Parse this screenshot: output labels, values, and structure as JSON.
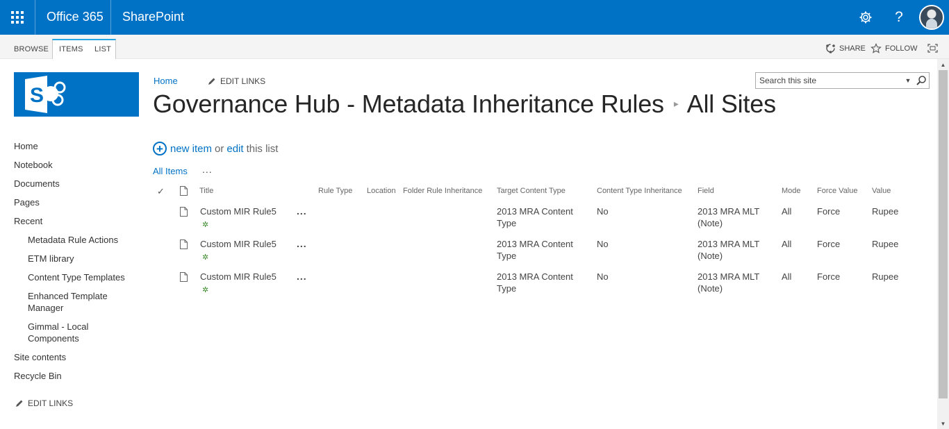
{
  "suitebar": {
    "brand": "Office 365",
    "app": "SharePoint",
    "icons": [
      "app-launcher-icon",
      "settings-gear-icon",
      "help-icon",
      "user-avatar"
    ],
    "help_glyph": "?",
    "color": "#0072c6"
  },
  "ribbon": {
    "tabs": [
      "BROWSE",
      "ITEMS",
      "LIST"
    ],
    "share": "SHARE",
    "follow": "FOLLOW"
  },
  "topnav": {
    "home": "Home",
    "edit_links": "EDIT LINKS"
  },
  "search": {
    "placeholder": "Search this site"
  },
  "title": {
    "site": "Governance Hub - Metadata Inheritance Rules",
    "list": "All Sites"
  },
  "quicklaunch": {
    "items": [
      "Home",
      "Notebook",
      "Documents",
      "Pages",
      "Recent"
    ],
    "recent": [
      "Metadata Rule Actions",
      "ETM library",
      "Content Type Templates",
      "Enhanced Template Manager",
      "Gimmal - Local Components"
    ],
    "bottom": [
      "Site contents",
      "Recycle Bin"
    ],
    "edit_links": "EDIT LINKS"
  },
  "toolbar": {
    "new_item": "new item",
    "or": "or",
    "edit": "edit",
    "this_list": "this list",
    "view": "All Items",
    "more": "..."
  },
  "table": {
    "columns": [
      "Title",
      "Rule Type",
      "Location",
      "Folder Rule Inheritance",
      "Target Content Type",
      "Content Type Inheritance",
      "Field",
      "Mode",
      "Force Value",
      "Value"
    ],
    "rows": [
      {
        "title": "Custom MIR Rule5",
        "rule_type": "",
        "location": "",
        "folder_rule_inheritance": "",
        "target_ct_1": "2013  MRA Content",
        "target_ct_2": "Type",
        "ct_inheritance": "No",
        "field_1": "2013 MRA MLT",
        "field_2": "(Note)",
        "mode": "All",
        "force": "Force",
        "value": "Rupee"
      },
      {
        "title": "Custom MIR Rule5",
        "rule_type": "",
        "location": "",
        "folder_rule_inheritance": "",
        "target_ct_1": "2013  MRA Content",
        "target_ct_2": "Type",
        "ct_inheritance": "No",
        "field_1": "2013 MRA MLT",
        "field_2": "(Note)",
        "mode": "All",
        "force": "Force",
        "value": "Rupee"
      },
      {
        "title": "Custom MIR Rule5",
        "rule_type": "",
        "location": "",
        "folder_rule_inheritance": "",
        "target_ct_1": "2013  MRA Content",
        "target_ct_2": "Type",
        "ct_inheritance": "No",
        "field_1": "2013 MRA MLT",
        "field_2": "(Note)",
        "mode": "All",
        "force": "Force",
        "value": "Rupee"
      }
    ],
    "new_badge_glyph": "✲",
    "item_menu_glyph": "..."
  }
}
